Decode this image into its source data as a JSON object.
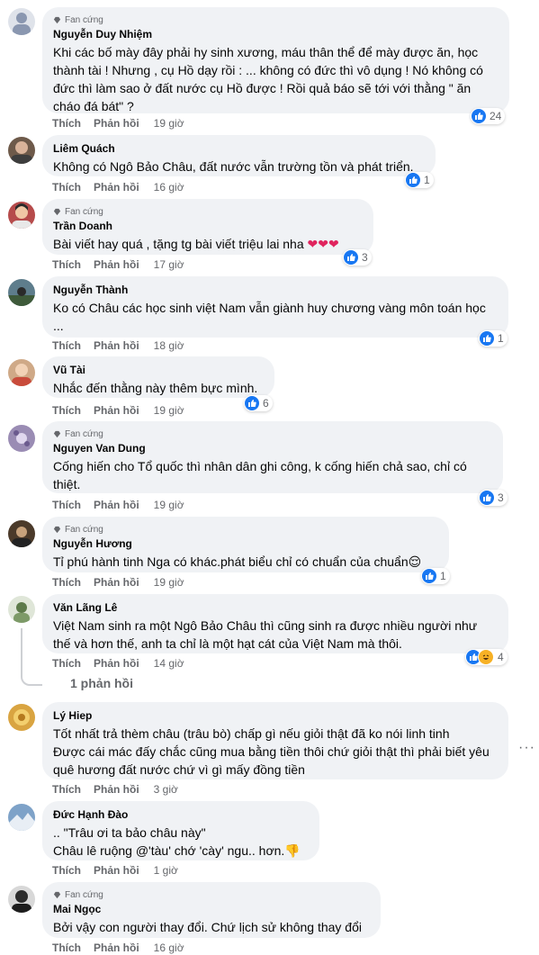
{
  "fan_badge": "Fan cứng",
  "like_label": "Thích",
  "reply_label": "Phản hồi",
  "comments": [
    {
      "name": "Nguyễn Duy Nhiệm",
      "text": "Khi các bố mày đây phải hy sinh xương, máu thân thể để mày được ăn, học thành tài ! Nhưng , cụ Hồ dạy rồi : ... không có đức thì vô dụng ! Nó không có đức thì làm sao ở đất nước cụ Hồ được ! Rồi quả báo sẽ tới với thằng \" ăn cháo đá bát\" ?",
      "time": "19 giờ",
      "reactions": "24"
    },
    {
      "name": "Liêm Quách",
      "text": "Không có Ngô Bảo Châu, đất nước vẫn trường tồn và phát triển.",
      "time": "16 giờ",
      "reactions": "1"
    },
    {
      "name": "Trần Doanh",
      "text": "Bài viết hay quá , tặng tg bài viết triệu lai nha",
      "emoji": "❤❤❤",
      "time": "17 giờ",
      "reactions": "3"
    },
    {
      "name": "Nguyễn Thành",
      "text": "Ko có Châu các học sinh việt Nam vẫn giành huy chương vàng môn toán học ...",
      "time": "18 giờ",
      "reactions": "1"
    },
    {
      "name": "Vũ Tài",
      "text": "Nhắc đến thằng này thêm bực mình.",
      "time": "19 giờ",
      "reactions": "6"
    },
    {
      "name": "Nguyen Van Dung",
      "text": "Cống hiến cho Tổ quốc thì nhân dân ghi công, k cống hiến chả sao, chỉ có thiệt.",
      "time": "19 giờ",
      "reactions": "3"
    },
    {
      "name": "Nguyễn Hương",
      "text": "Tỉ phú hành tinh Nga có khác.phát biểu chỉ có chuẩn của chuẩn",
      "emoji": "😌",
      "time": "19 giờ",
      "reactions": "1"
    },
    {
      "name": "Văn Lãng Lê",
      "text": "Việt Nam sinh ra một Ngô Bảo Châu thì cũng sinh ra được nhiều người như thế và hơn thế, anh ta chỉ là một hạt cát của Việt Nam mà thôi.",
      "time": "14 giờ",
      "reactions": "4",
      "replies": "1 phản hồi"
    },
    {
      "name": "Lý Hiep",
      "text": "Tốt nhất trả thèm châu (trâu bò) chấp gì nếu giỏi thật đã ko nói linh tinh\nĐược cái mác đấy chắc cũng mua bằng tiền thôi chứ giỏi thật thì phải biết yêu quê hương đất nước chứ vì gì mấy đồng tiền",
      "time": "3 giờ"
    },
    {
      "name": "Đức Hạnh Đào",
      "text": ".. \"Trâu ơi ta bảo châu này\"\nChâu lê ruộng @'tàu' chớ 'cày' ngu.. hơn.",
      "emoji": "👎",
      "time": "1 giờ"
    },
    {
      "name": "Mai Ngọc",
      "text": "Bởi vậy con người thay đổi. Chứ lịch sử không thay đổi",
      "time": "16 giờ"
    }
  ],
  "icons": {
    "more": "more-options-icon",
    "like": "like-reaction-icon",
    "haha": "haha-reaction-icon",
    "fan": "fan-badge-icon"
  }
}
